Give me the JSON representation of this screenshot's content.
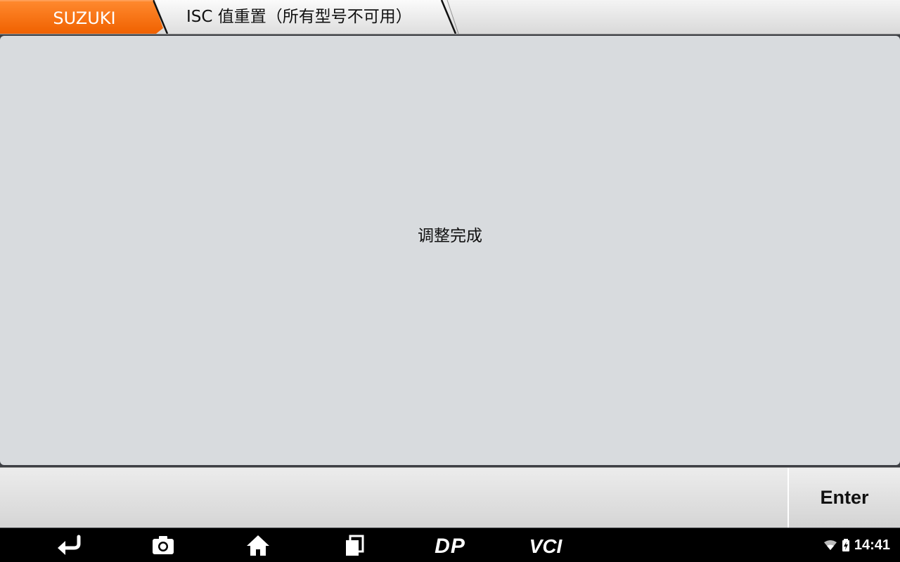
{
  "breadcrumb": {
    "items": [
      {
        "label": "SUZUKI",
        "active": true
      },
      {
        "label": "ISC 值重置（所有型号不可用）",
        "active": false
      }
    ],
    "accent_color": "#ff6a00"
  },
  "main": {
    "message": "调整完成"
  },
  "footer": {
    "enter_label": "Enter"
  },
  "navbar": {
    "buttons": [
      {
        "icon": "back-icon"
      },
      {
        "icon": "camera-icon"
      },
      {
        "icon": "home-icon"
      },
      {
        "icon": "recent-apps-icon"
      },
      {
        "icon": "dp-logo-icon"
      },
      {
        "icon": "vci-icon"
      }
    ],
    "dp_label": "DP",
    "vci_label": "VCI",
    "status": {
      "wifi": "wifi-icon",
      "battery": "battery-charging-icon",
      "time": "14:41"
    }
  }
}
